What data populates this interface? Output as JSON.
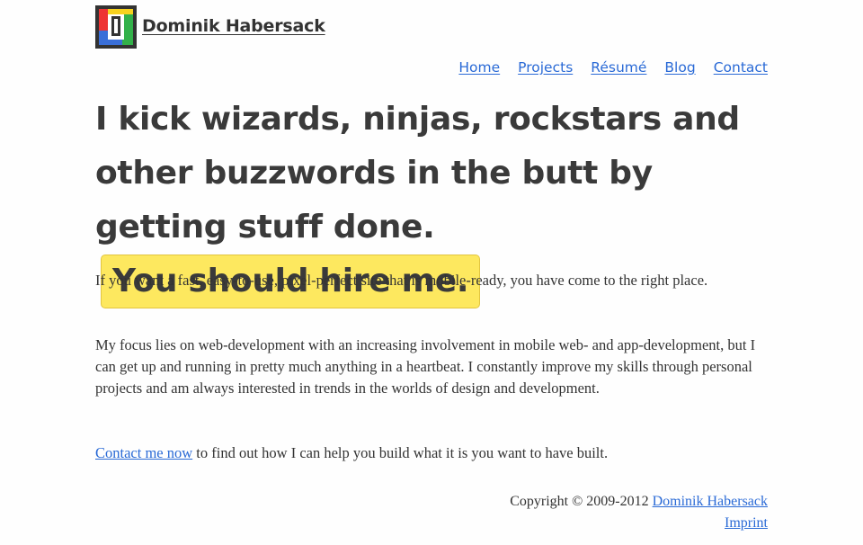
{
  "header": {
    "site_name": "Dominik Habersack",
    "logo_icon": "pixel-logo-icon"
  },
  "nav": {
    "items": [
      {
        "label": "Home"
      },
      {
        "label": "Projects"
      },
      {
        "label": "Résumé"
      },
      {
        "label": "Blog"
      },
      {
        "label": "Contact"
      }
    ]
  },
  "hero": {
    "headline": "I kick wizards, ninjas, rockstars and other buzzwords in the butt by getting stuff done.",
    "cta": "You should hire me."
  },
  "main": {
    "paragraph1": "If you want a fast, easy-to-use, pixel-perfect site that is mobile-ready, you have come to the right place.",
    "paragraph2": "My focus lies on web-development with an increasing involvement in mobile web- and app-development, but I can get up and running in pretty much anything in a heartbeat. I constantly improve my skills through personal projects and am always interested in trends in the worlds of design and development.",
    "contact_link": "Contact me now",
    "contact_rest": " to find out how I can help you build what it is you want to have built."
  },
  "footer": {
    "copyright": "Copyright © 2009-2012 ",
    "author_link": "Dominik Habersack",
    "imprint_link": "Imprint"
  },
  "colors": {
    "link": "#2a6ad6",
    "highlight": "#fde85f",
    "text": "#333333"
  }
}
